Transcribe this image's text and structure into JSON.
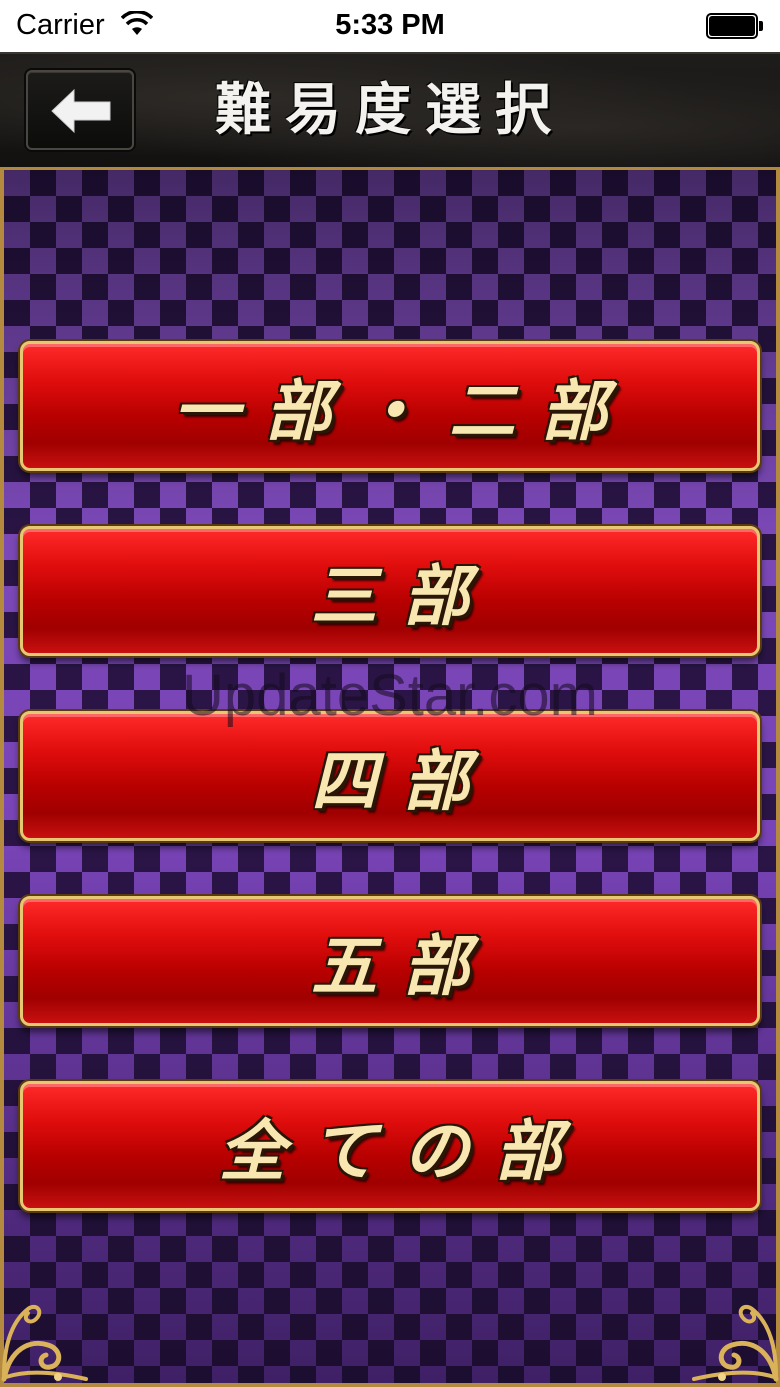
{
  "status_bar": {
    "carrier": "Carrier",
    "time": "5:33 PM",
    "wifi_icon": "wifi-icon",
    "battery_icon": "battery-icon"
  },
  "header": {
    "back_icon": "back-arrow-icon",
    "title": "難易度選択"
  },
  "menu": {
    "items": [
      {
        "label": "一部・二部"
      },
      {
        "label": "三部"
      },
      {
        "label": "四部"
      },
      {
        "label": "五部"
      },
      {
        "label": "全ての部"
      }
    ]
  },
  "watermark": "UpdateStar.com",
  "colors": {
    "button_red": "#d10000",
    "button_border_gold": "#e8c773",
    "label_gold": "#f8e7b0",
    "pattern_dark": "#2b1547",
    "pattern_light": "#8b55c9",
    "frame_gold": "#b48a3e"
  }
}
